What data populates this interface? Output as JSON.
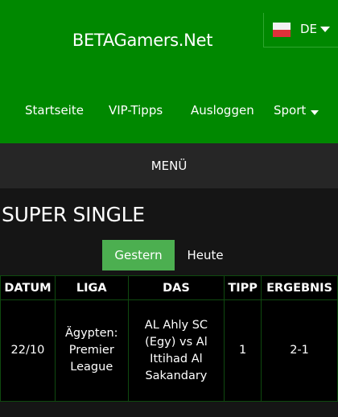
{
  "header": {
    "brand": "BETAGamers.Net",
    "language": {
      "code": "DE",
      "flag_icon": "germany-flag-icon"
    },
    "nav": [
      {
        "label": "Startseite"
      },
      {
        "label": "VIP-Tipps"
      },
      {
        "label": "Ausloggen"
      },
      {
        "label": "Sport"
      }
    ]
  },
  "menu": {
    "label": "MENÜ"
  },
  "page": {
    "title": "SUPER SINGLE"
  },
  "tabs": [
    {
      "label": "Gestern",
      "active": true
    },
    {
      "label": "Heute",
      "active": false
    }
  ],
  "table": {
    "headers": [
      "DATUM",
      "LIGA",
      "DAS",
      "TIPP",
      "ERGEBNIS"
    ],
    "rows": [
      {
        "date": "22/10",
        "league": "Ägypten: Premier League",
        "match": "AL Ahly SC (Egy) vs Al Ittihad Al Sakandary",
        "tip": "1",
        "result": "2-1"
      }
    ]
  },
  "colors": {
    "header_green": "#008800",
    "tab_active": "#4caf50",
    "menu_bar": "#262626",
    "background": "#151515"
  }
}
